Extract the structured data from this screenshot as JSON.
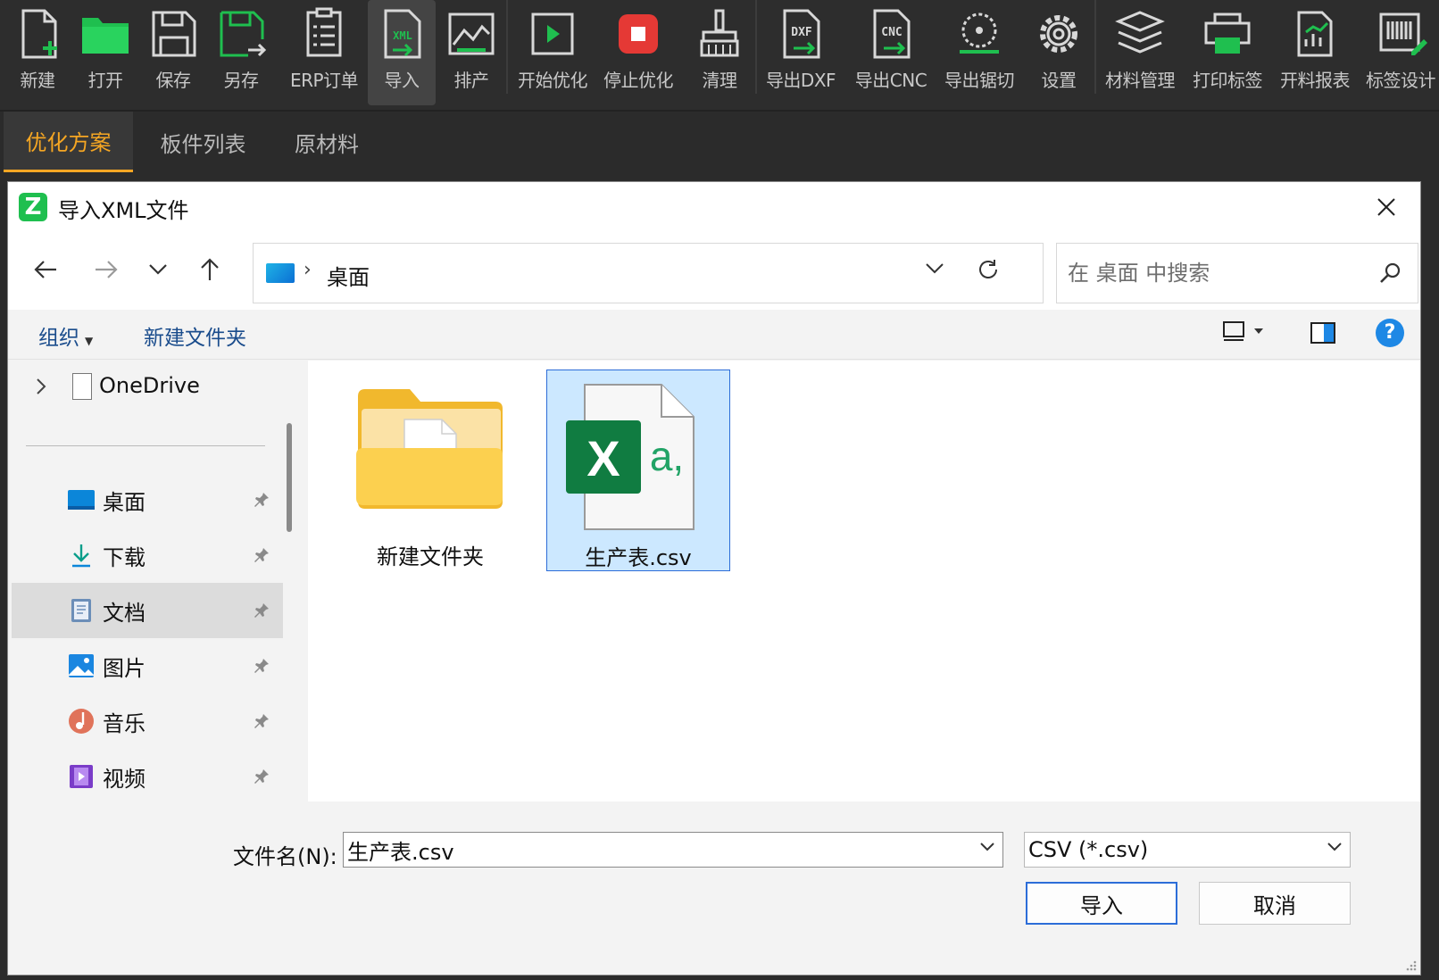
{
  "toolbar": {
    "items": [
      {
        "label": "新建",
        "icon": "new-file-icon"
      },
      {
        "label": "打开",
        "icon": "open-folder-icon"
      },
      {
        "label": "保存",
        "icon": "save-icon"
      },
      {
        "label": "另存",
        "icon": "save-as-icon"
      },
      {
        "label": "ERP订单",
        "icon": "erp-order-icon"
      },
      {
        "label": "导入",
        "icon": "import-xml-icon"
      },
      {
        "label": "排产",
        "icon": "schedule-chart-icon"
      },
      {
        "label": "开始优化",
        "icon": "play-icon"
      },
      {
        "label": "停止优化",
        "icon": "stop-icon"
      },
      {
        "label": "清理",
        "icon": "broom-icon"
      },
      {
        "label": "导出DXF",
        "icon": "export-dxf-icon"
      },
      {
        "label": "导出CNC",
        "icon": "export-cnc-icon"
      },
      {
        "label": "导出锯切",
        "icon": "saw-blade-icon"
      },
      {
        "label": "设置",
        "icon": "gear-icon"
      },
      {
        "label": "材料管理",
        "icon": "layers-icon"
      },
      {
        "label": "打印标签",
        "icon": "printer-icon"
      },
      {
        "label": "开料报表",
        "icon": "report-icon"
      },
      {
        "label": "标签设计",
        "icon": "barcode-edit-icon"
      }
    ],
    "xml_badge": "XML",
    "dxf_badge": "DXF",
    "cnc_badge": "CNC"
  },
  "tabs": [
    "优化方案",
    "板件列表",
    "原材料"
  ],
  "dialog": {
    "title": "导入XML文件",
    "logo_letter": "Z",
    "address": {
      "location": "桌面"
    },
    "search": {
      "placeholder": "在 桌面 中搜索"
    },
    "commands": {
      "organize": "组织",
      "new_folder": "新建文件夹"
    },
    "nav": {
      "onedrive": "OneDrive",
      "items": [
        {
          "label": "桌面",
          "icon": "desktop-icon"
        },
        {
          "label": "下载",
          "icon": "download-icon"
        },
        {
          "label": "文档",
          "icon": "documents-icon"
        },
        {
          "label": "图片",
          "icon": "pictures-icon"
        },
        {
          "label": "音乐",
          "icon": "music-icon"
        },
        {
          "label": "视频",
          "icon": "video-icon"
        }
      ]
    },
    "files": [
      {
        "name": "新建文件夹",
        "type": "folder"
      },
      {
        "name": "生产表.csv",
        "type": "excel-csv"
      }
    ],
    "excel_letters": {
      "x": "X",
      "a": "a,"
    },
    "filename_label": "文件名(N):",
    "filename_value": "生产表.csv",
    "filter": "CSV (*.csv)",
    "buttons": {
      "import": "导入",
      "cancel": "取消"
    },
    "help": "?"
  },
  "colors": {
    "accent_orange": "#f5a623",
    "icon_green": "#1fbf4f",
    "stop_red": "#e53935",
    "selection": "#cce8ff",
    "help_blue": "#1e88e5",
    "excel_green": "#107c41"
  }
}
